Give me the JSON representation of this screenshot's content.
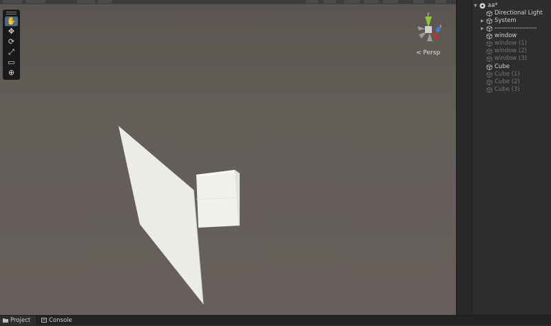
{
  "scene_view": {
    "projection_label": "Persp",
    "gizmo_axes": {
      "y": "y",
      "z": "z"
    },
    "tools": [
      {
        "name": "hand",
        "glyph": "✋",
        "active": true
      },
      {
        "name": "move",
        "glyph": "✥",
        "active": false
      },
      {
        "name": "rotate",
        "glyph": "⟳",
        "active": false
      },
      {
        "name": "scale",
        "glyph": "⤢",
        "active": false
      },
      {
        "name": "rect",
        "glyph": "▭",
        "active": false
      },
      {
        "name": "transform",
        "glyph": "⊕",
        "active": false
      }
    ]
  },
  "hierarchy": {
    "scene_name": "aa*",
    "items": [
      {
        "label": "Directional Light",
        "enabled": true,
        "expandable": false
      },
      {
        "label": "System",
        "enabled": true,
        "expandable": true
      },
      {
        "label": "--------------------",
        "enabled": true,
        "expandable": true
      },
      {
        "label": "window",
        "enabled": true,
        "expandable": false
      },
      {
        "label": "window (1)",
        "enabled": false,
        "expandable": false
      },
      {
        "label": "window (2)",
        "enabled": false,
        "expandable": false
      },
      {
        "label": "window (3)",
        "enabled": false,
        "expandable": false
      },
      {
        "label": "Cube",
        "enabled": true,
        "expandable": false
      },
      {
        "label": "Cube (1)",
        "enabled": false,
        "expandable": false
      },
      {
        "label": "Cube (2)",
        "enabled": false,
        "expandable": false
      },
      {
        "label": "Cube (3)",
        "enabled": false,
        "expandable": false
      }
    ]
  },
  "bottom_tabs": [
    {
      "label": "Project",
      "icon": "folder-icon",
      "active": true
    },
    {
      "label": "Console",
      "icon": "console-icon",
      "active": false
    }
  ],
  "colors": {
    "scene_bg": "#645e59",
    "object_white": "#ecece7",
    "gizmo_y": "#8cc63f",
    "gizmo_x": "#d0453a",
    "gizmo_z": "#3d7ad6"
  }
}
